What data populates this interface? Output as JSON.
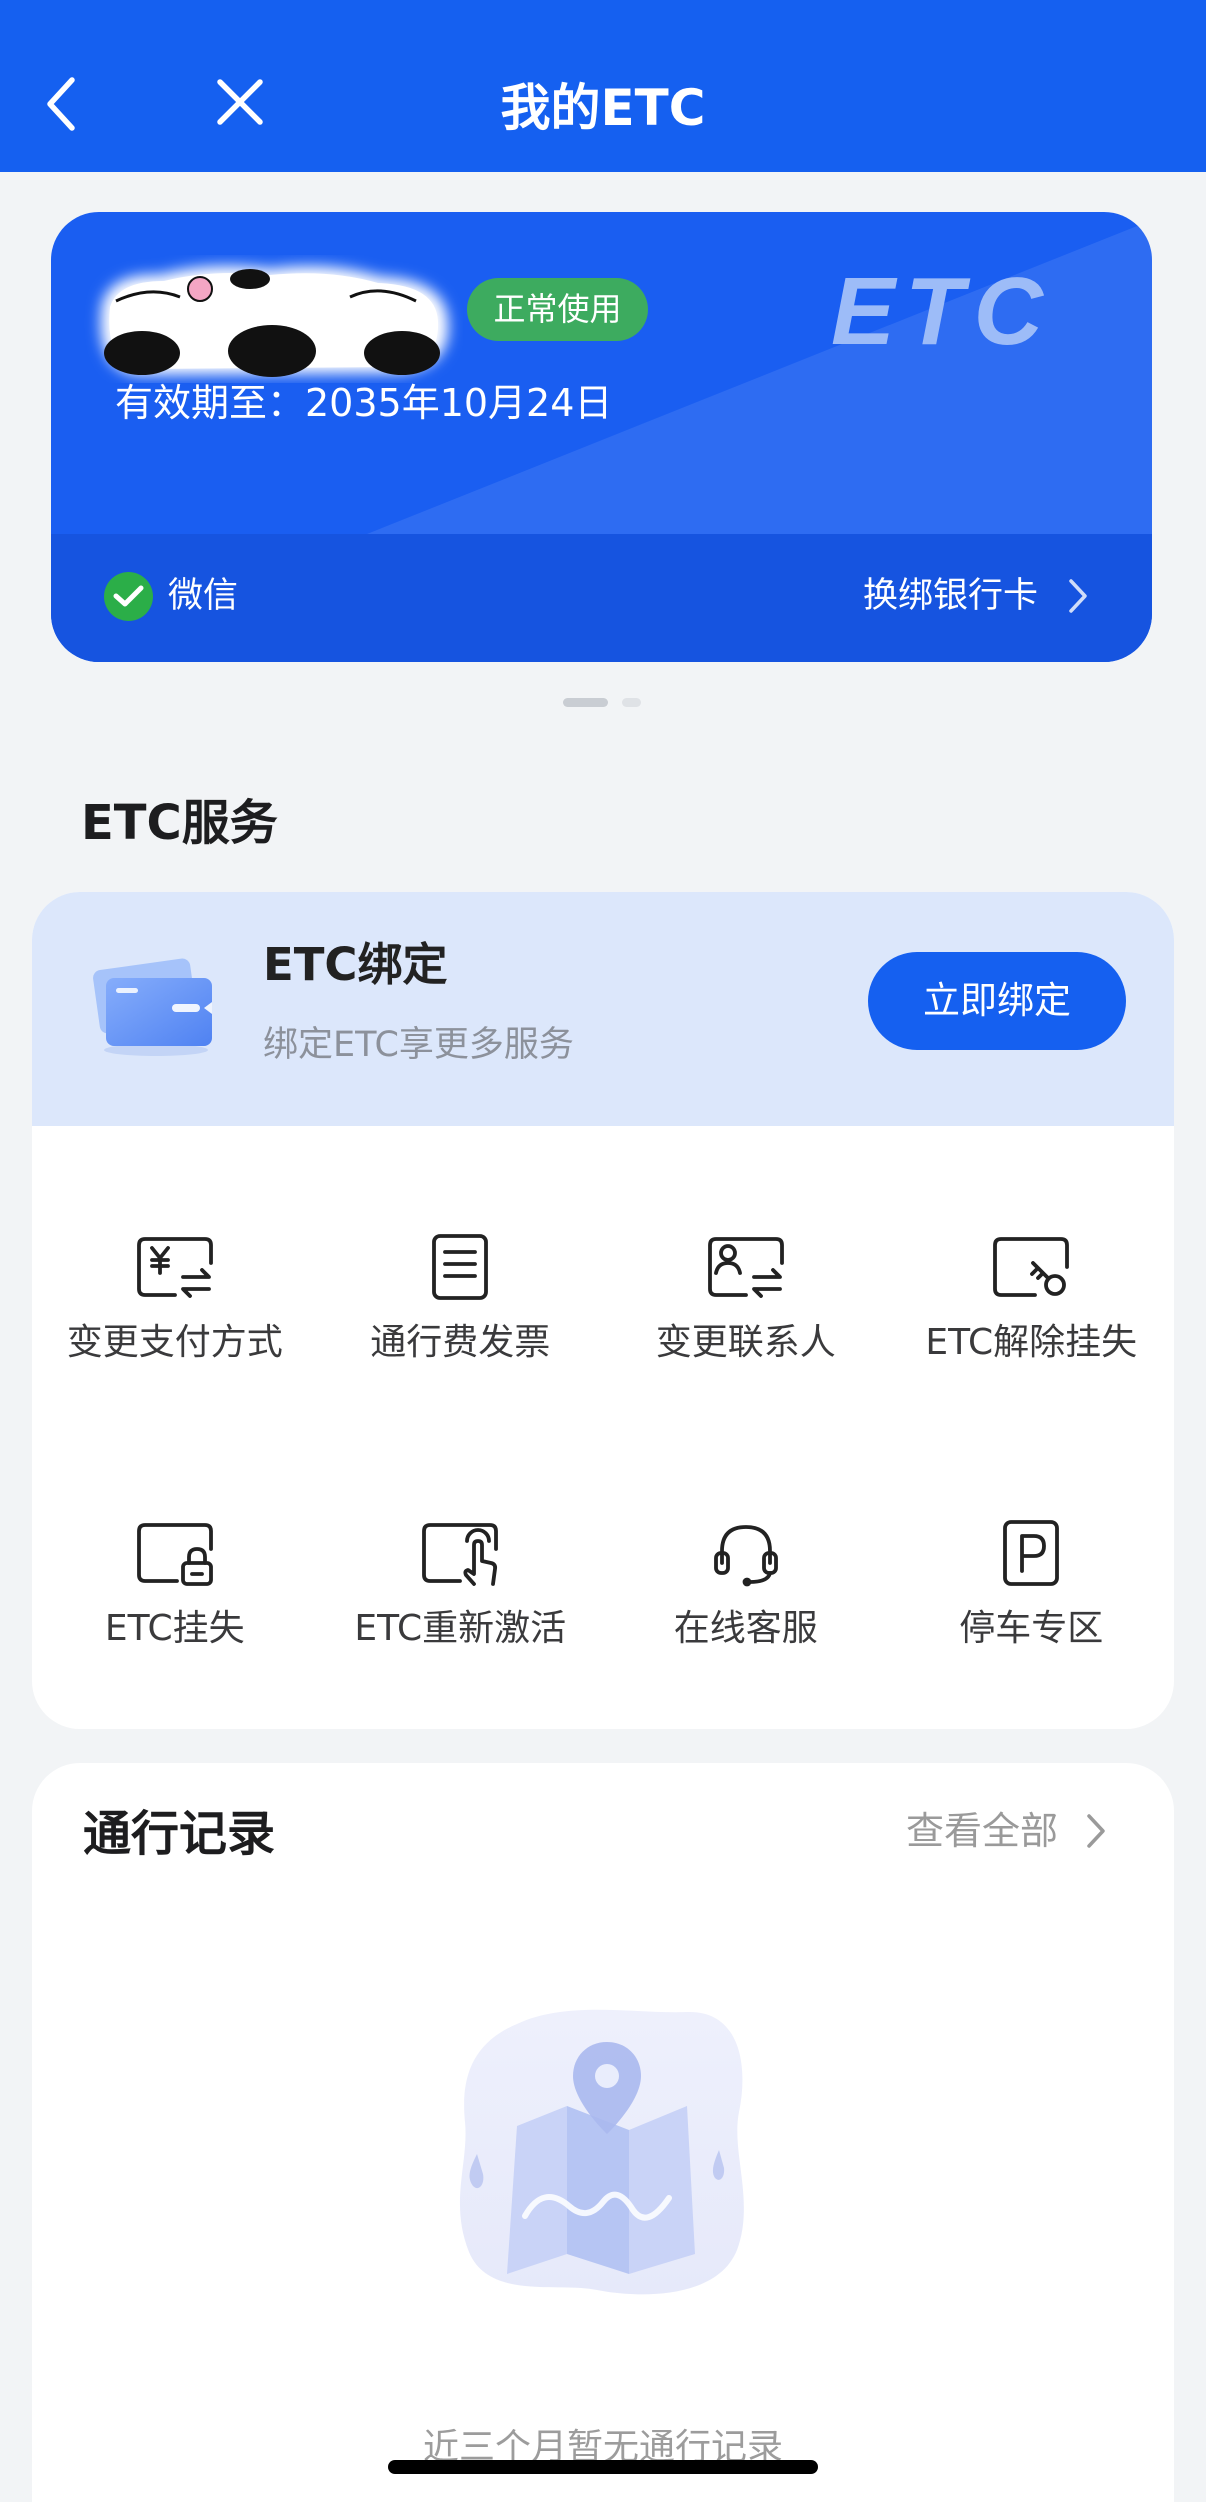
{
  "header": {
    "title": "我的ETC",
    "back_icon": "chevron-left-icon",
    "close_icon": "close-icon"
  },
  "etc_card": {
    "status_badge": "正常使用",
    "validity": "有效期至：2035年10月24日",
    "logo_text": "ETC",
    "payment_icon": "wechat-pay-icon",
    "payment_method": "微信",
    "rebind_label": "换绑银行卡"
  },
  "carousel": {
    "page_count": 2,
    "active_index": 0
  },
  "services": {
    "heading": "ETC服务",
    "bind": {
      "title": "ETC绑定",
      "subtitle": "绑定ETC享更多服务",
      "button": "立即绑定"
    },
    "items": [
      {
        "label": "变更支付方式",
        "icon": "payment-switch-icon"
      },
      {
        "label": "通行费发票",
        "icon": "invoice-icon"
      },
      {
        "label": "变更联系人",
        "icon": "contact-switch-icon"
      },
      {
        "label": "ETC解除挂失",
        "icon": "key-unlock-icon"
      },
      {
        "label": "ETC挂失",
        "icon": "lock-icon"
      },
      {
        "label": "ETC重新激活",
        "icon": "tap-activate-icon"
      },
      {
        "label": "在线客服",
        "icon": "headset-icon"
      },
      {
        "label": "停车专区",
        "icon": "parking-icon"
      }
    ]
  },
  "records": {
    "heading": "通行记录",
    "view_all": "查看全部",
    "empty_text": "近三个月暂无通行记录"
  },
  "colors": {
    "primary": "#1560f0",
    "card_blue": "#1a5ef1",
    "card_footer_blue": "#1654e0",
    "status_green": "#3dab5f",
    "wechat_green": "#2bae48",
    "service_header_bg": "#dce7fb",
    "page_bg": "#f2f4f6"
  }
}
